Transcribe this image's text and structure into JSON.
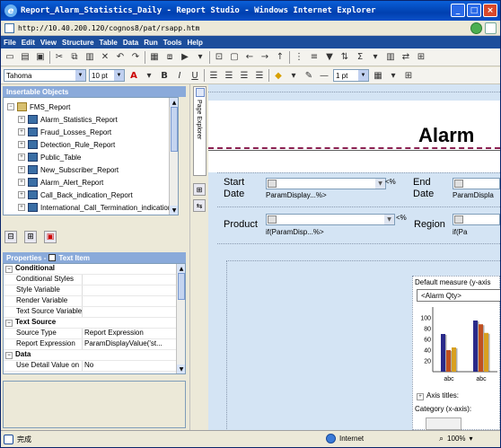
{
  "window": {
    "title": "Report_Alarm_Statistics_Daily - Report Studio - Windows Internet Explorer",
    "minimize": "_",
    "maximize": "□",
    "close": "×"
  },
  "address": {
    "url": "http://10.40.200.120/cognos8/pat/rsapp.htm"
  },
  "menu": [
    "File",
    "Edit",
    "View",
    "Structure",
    "Table",
    "Data",
    "Run",
    "Tools",
    "Help"
  ],
  "format_toolbar": {
    "font": "Tahoma",
    "size": "10 pt",
    "line_weight": "1 pt"
  },
  "insertable_objects": {
    "header": "Insertable Objects",
    "root": "FMS_Report",
    "items": [
      "Alarm_Statistics_Report",
      "Fraud_Losses_Report",
      "Detection_Rule_Report",
      "Public_Table",
      "New_Subscriber_Report",
      "Alarm_Alert_Report",
      "Call_Back_indication_Report",
      "International_Call_Termination_indication"
    ]
  },
  "properties": {
    "header": "Properties - ",
    "context": "Text Item",
    "sections": [
      {
        "title": "Conditional",
        "rows": [
          {
            "k": "Conditional Styles",
            "v": ""
          },
          {
            "k": "Style Variable",
            "v": ""
          },
          {
            "k": "Render Variable",
            "v": ""
          },
          {
            "k": "Text Source Variable",
            "v": ""
          }
        ]
      },
      {
        "title": "Text Source",
        "rows": [
          {
            "k": "Source Type",
            "v": "Report Expression"
          },
          {
            "k": "Report Expression",
            "v": "ParamDisplayValue('st..."
          }
        ]
      },
      {
        "title": "Data",
        "rows": [
          {
            "k": "Use Detail Value on Page",
            "v": "No"
          }
        ]
      }
    ]
  },
  "side_tab": {
    "label": "Page Explorer"
  },
  "canvas": {
    "title": "Alarm",
    "start_date_label": "Start Date",
    "end_date_label": "End Date",
    "product_label": "Product",
    "region_label": "Region",
    "start_param": "ParamDisplay...%>",
    "end_param": "ParamDispla",
    "product_param": "if(ParamDisp...%>",
    "region_param": "if(Pa",
    "lt_marker": "<%",
    "chart": {
      "default_measure": "Default measure (y-axis",
      "measure_value": "<Alarm Qty>",
      "axis_titles": "Axis titles:",
      "category": "Category (x-axis):"
    }
  },
  "chart_data": {
    "type": "bar",
    "categories": [
      "abc",
      "abc"
    ],
    "series": [
      {
        "values": [
          70,
          95
        ]
      },
      {
        "values": [
          40,
          88
        ]
      },
      {
        "values": [
          45,
          72
        ]
      }
    ],
    "ylim": [
      0,
      120
    ],
    "yticks": [
      20,
      40,
      60,
      80,
      100
    ],
    "colors": [
      "#2a2a8a",
      "#c05020",
      "#d8a020"
    ]
  },
  "status": {
    "text": "完成",
    "zone": "Internet",
    "zoom": "100%"
  }
}
